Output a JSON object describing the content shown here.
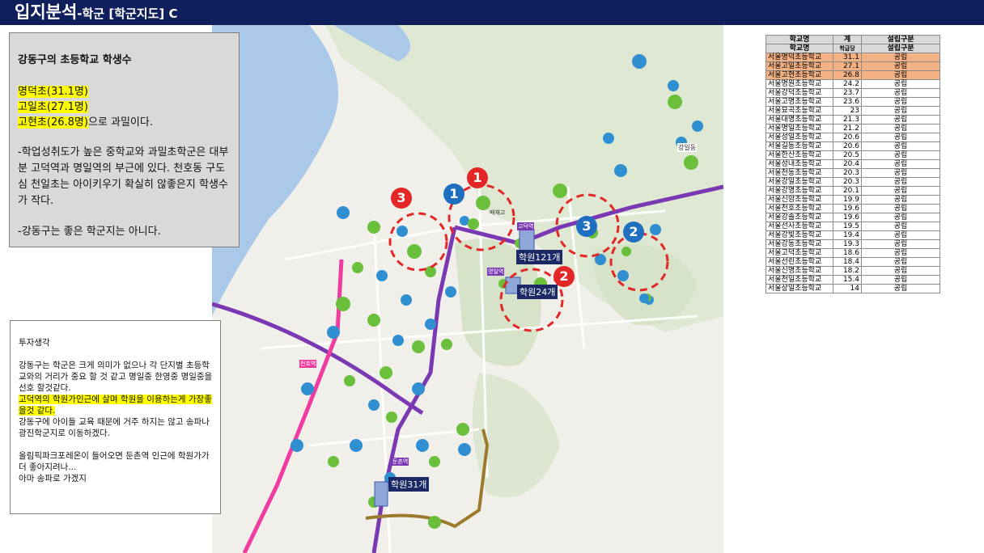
{
  "title": {
    "main": "입지분석",
    "sub": "-학군 [학군지도] C"
  },
  "summary": {
    "heading": "강동구의 초등학교 학생수",
    "highlights": [
      "명덕초(31.1명)",
      "고일초(27.1명)",
      "고현초(26.8명)"
    ],
    "suffix": "으로 과밀이다.",
    "para1": "-학업성취도가 높은 중학교와 과밀초학군은 대부분 고덕역과 명일역의 부근에 있다. 천호동 구도심 천일초는 아이키우기 확실히 않좋은지 학생수가 작다.",
    "para2": "-강동구는 좋은 학군지는 아니다."
  },
  "thoughts": {
    "heading": "투자생각",
    "p1": "강동구는 학군은 크게 의미가 없으나 각 단지별 초등학교와의 거리가 중요 할 것 같고 명일중 한영중 명일중을 선호 할것같다.",
    "p2_highlight": "고덕역의 학원가인근에 살며 학원을 이용하는게 가장좋을것 같다.",
    "p3": "강동구에 아이들 교육 때문에 거주 하지는 않고 송파나 광진학군지로 이동하겠다.",
    "p4": "올림픽파크포레온이  들어오면 둔촌역 인근에 학원가가 더 좋아지려나...",
    "p5": "아마 송파로 가겠지"
  },
  "map": {
    "academy_labels": [
      "학원121개",
      "학원24개",
      "학원31개"
    ],
    "markers": [
      {
        "num": "1",
        "color": "#e32626"
      },
      {
        "num": "2",
        "color": "#e32626"
      },
      {
        "num": "3",
        "color": "#e32626"
      },
      {
        "num": "1",
        "color": "#1e6fc0"
      },
      {
        "num": "2",
        "color": "#1e6fc0"
      },
      {
        "num": "3",
        "color": "#1e6fc0"
      }
    ],
    "place_labels": [
      "강일동",
      "고덕역",
      "명일역",
      "천호역",
      "둔촌역",
      "배재고"
    ]
  },
  "table": {
    "headers": [
      "학교명",
      "계",
      "설립구분"
    ],
    "filter_headers": [
      "학교명",
      "학급당",
      "설립구분"
    ],
    "rows": [
      [
        "서울명덕초등학교",
        "31.1",
        "공립"
      ],
      [
        "서울고일초등학교",
        "27.1",
        "공립"
      ],
      [
        "서울고현초등학교",
        "26.8",
        "공립"
      ],
      [
        "서울명원초등학교",
        "24.2",
        "공립"
      ],
      [
        "서울강덕초등학교",
        "23.7",
        "공립"
      ],
      [
        "서울고명초등학교",
        "23.6",
        "공립"
      ],
      [
        "서울묘곡초등학교",
        "23",
        "공립"
      ],
      [
        "서울대명초등학교",
        "21.3",
        "공립"
      ],
      [
        "서울명일초등학교",
        "21.2",
        "공립"
      ],
      [
        "서울성일초등학교",
        "20.6",
        "공립"
      ],
      [
        "서울길동초등학교",
        "20.6",
        "공립"
      ],
      [
        "서울한산초등학교",
        "20.5",
        "공립"
      ],
      [
        "서울성내초등학교",
        "20.4",
        "공립"
      ],
      [
        "서울천동초등학교",
        "20.3",
        "공립"
      ],
      [
        "서울강일초등학교",
        "20.3",
        "공립"
      ],
      [
        "서울강명초등학교",
        "20.1",
        "공립"
      ],
      [
        "서울신암초등학교",
        "19.9",
        "공립"
      ],
      [
        "서울천호초등학교",
        "19.6",
        "공립"
      ],
      [
        "서울강솔초등학교",
        "19.6",
        "공립"
      ],
      [
        "서울선사초등학교",
        "19.5",
        "공립"
      ],
      [
        "서울강빛초등학교",
        "19.4",
        "공립"
      ],
      [
        "서울강동초등학교",
        "19.3",
        "공립"
      ],
      [
        "서울고덕초등학교",
        "18.6",
        "공립"
      ],
      [
        "서울선린초등학교",
        "18.4",
        "공립"
      ],
      [
        "서울신명초등학교",
        "18.2",
        "공립"
      ],
      [
        "서울천일초등학교",
        "15.4",
        "공립"
      ],
      [
        "서울상일초등학교",
        "14",
        "공립"
      ]
    ]
  }
}
